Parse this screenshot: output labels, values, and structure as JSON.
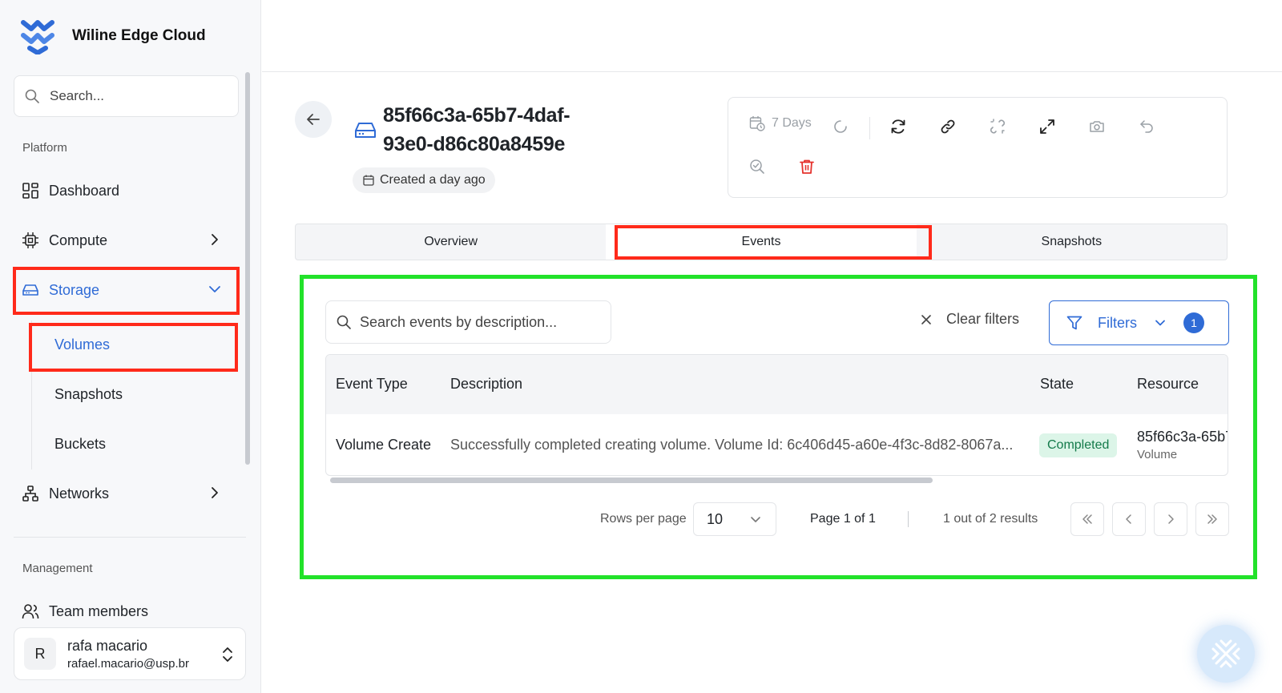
{
  "brand": {
    "name": "Wiline Edge Cloud"
  },
  "sidebar": {
    "search_placeholder": "Search...",
    "platform_label": "Platform",
    "items": [
      {
        "label": "Dashboard",
        "icon": "dashboard-icon"
      },
      {
        "label": "Compute",
        "icon": "cpu-icon"
      },
      {
        "label": "Storage",
        "icon": "storage-icon"
      },
      {
        "label": "Networks",
        "icon": "network-icon"
      }
    ],
    "storage_sub": [
      "Volumes",
      "Snapshots",
      "Buckets"
    ],
    "management_label": "Management",
    "management_items": [
      {
        "label": "Team members",
        "icon": "users-icon"
      }
    ],
    "user": {
      "initial": "R",
      "name": "rafa macario",
      "email": "rafael.macario@usp.br"
    }
  },
  "volume": {
    "title": "85f66c3a-65b7-4daf-93e0-d86c80a8459e",
    "created": "Created a day ago"
  },
  "toolbar": {
    "range_label": "7 Days",
    "icons": [
      "calendar-clock-icon",
      "loading-icon",
      "refresh-icon",
      "link-icon",
      "unlink-icon",
      "expand-icon",
      "camera-icon",
      "undo-icon",
      "inspect-icon",
      "delete-icon"
    ],
    "delete_color": "#e5322d"
  },
  "tabs": [
    "Overview",
    "Events",
    "Snapshots"
  ],
  "events": {
    "search_placeholder": "Search events by description...",
    "clear_filters": "Clear filters",
    "filters_label": "Filters",
    "filters_count": "1",
    "columns": [
      "Event Type",
      "Description",
      "State",
      "Resource"
    ],
    "rows": [
      {
        "event_type": "Volume Create",
        "description": "Successfully completed creating volume. Volume Id: 6c406d45-a60e-4f3c-8d82-8067a...",
        "state": "Completed",
        "resource_name": "85f66c3a-65b7",
        "resource_type": "Volume"
      }
    ],
    "rows_per_page_label": "Rows per page",
    "rows_per_page": "10",
    "page_label": "Page 1 of 1",
    "results_label": "1 out of 2 results"
  },
  "colors": {
    "accent": "#2f6bd6",
    "success_bg": "#dcf5e8",
    "success_text": "#137a4a",
    "highlight_red": "#ff2a1a",
    "highlight_green": "#22e22a"
  }
}
